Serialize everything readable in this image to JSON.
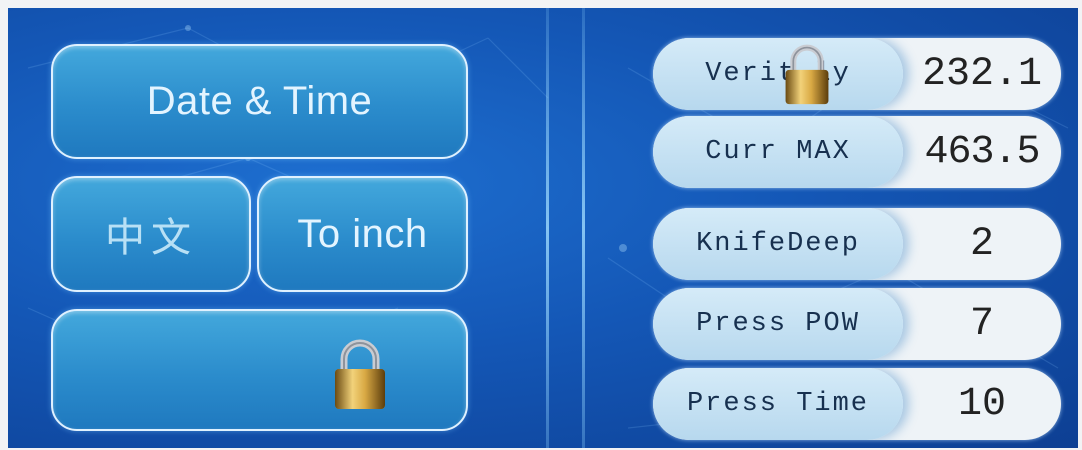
{
  "left_panel": {
    "date_time_label": "Date & Time",
    "chinese_label": "中文",
    "to_inch_label": "To inch"
  },
  "right_panel": {
    "rows": [
      {
        "label": "Verit  ly",
        "value": "232.1"
      },
      {
        "label": "Curr MAX",
        "value": "463.5"
      },
      {
        "label": "KnifeDeep",
        "value": "2"
      },
      {
        "label": "Press POW",
        "value": "7"
      },
      {
        "label": "Press Time",
        "value": "10"
      }
    ]
  },
  "icons": {
    "lock": "padlock-icon"
  },
  "colors": {
    "screen_bg": "#1457b6",
    "button_fill": "#2b8ccc",
    "button_border": "#dff1ff",
    "row_label_bg": "#c6e1f3",
    "row_value_bg": "#eef3f7"
  }
}
